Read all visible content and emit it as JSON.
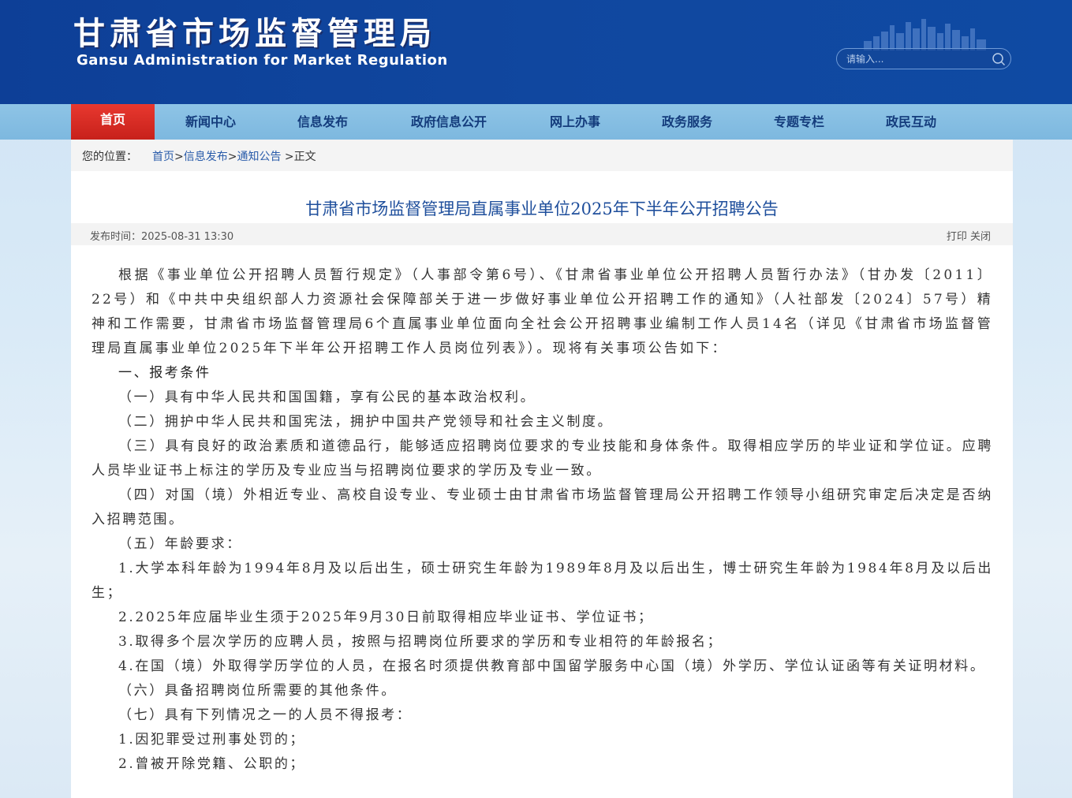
{
  "header": {
    "title_cn": "甘肃省市场监督管理局",
    "title_en": "Gansu Administration for Market Regulation",
    "search_placeholder": "请输入..."
  },
  "nav": {
    "items": [
      "首页",
      "新闻中心",
      "信息发布",
      "政府信息公开",
      "网上办事",
      "政务服务",
      "专题专栏",
      "政民互动"
    ],
    "active_index": 0
  },
  "breadcrumb": {
    "label": "您的位置：",
    "home": "首页",
    "sep1": ">",
    "info": "信息发布",
    "sep2": ">",
    "notice": "通知公告",
    "current": ">正文"
  },
  "article": {
    "title": "甘肃省市场监督管理局直属事业单位2025年下半年公开招聘公告",
    "publish_time": "发布时间：2025-08-31 13:30",
    "print": "打印",
    "close": "关闭",
    "paragraphs": [
      "根据《事业单位公开招聘人员暂行规定》（人事部令第6号）、《甘肃省事业单位公开招聘人员暂行办法》（甘办发〔2011〕22号）和《中共中央组织部人力资源社会保障部关于进一步做好事业单位公开招聘工作的通知》（人社部发〔2024〕57号）精神和工作需要，甘肃省市场监督管理局6个直属事业单位面向全社会公开招聘事业编制工作人员14名（详见《甘肃省市场监督管理局直属事业单位2025年下半年公开招聘工作人员岗位列表》）。现将有关事项公告如下：",
      "一、报考条件",
      "（一）具有中华人民共和国国籍，享有公民的基本政治权利。",
      "（二）拥护中华人民共和国宪法，拥护中国共产党领导和社会主义制度。",
      "（三）具有良好的政治素质和道德品行，能够适应招聘岗位要求的专业技能和身体条件。取得相应学历的毕业证和学位证。应聘人员毕业证书上标注的学历及专业应当与招聘岗位要求的学历及专业一致。",
      "（四）对国（境）外相近专业、高校自设专业、专业硕士由甘肃省市场监督管理局公开招聘工作领导小组研究审定后决定是否纳入招聘范围。",
      "（五）年龄要求：",
      "1.大学本科年龄为1994年8月及以后出生，硕士研究生年龄为1989年8月及以后出生，博士研究生年龄为1984年8月及以后出生；",
      "2.2025年应届毕业生须于2025年9月30日前取得相应毕业证书、学位证书；",
      "3.取得多个层次学历的应聘人员，按照与招聘岗位所要求的学历和专业相符的年龄报名；",
      "4.在国（境）外取得学历学位的人员，在报名时须提供教育部中国留学服务中心国（境）外学历、学位认证函等有关证明材料。",
      "（六）具备招聘岗位所需要的其他条件。",
      "（七）具有下列情况之一的人员不得报考：",
      "1.因犯罪受过刑事处罚的；",
      "2.曾被开除党籍、公职的；"
    ]
  }
}
